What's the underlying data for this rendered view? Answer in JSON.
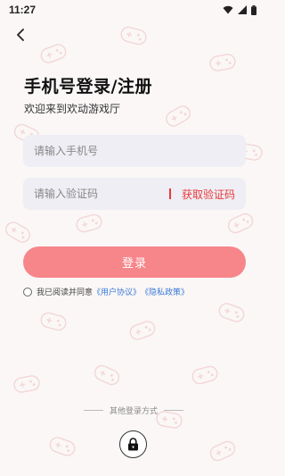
{
  "status_bar": {
    "time": "11:27"
  },
  "page": {
    "title": "手机号登录/注册",
    "subtitle": "欢迎来到欢动游戏厅"
  },
  "phone_field": {
    "placeholder": "请输入手机号"
  },
  "code_field": {
    "placeholder": "请输入验证码",
    "get_code_label": "获取验证码"
  },
  "login_button": {
    "label": "登录"
  },
  "agreement": {
    "prefix": "我已阅读并同意",
    "user_agreement": "《用户协议》",
    "privacy_policy": "《隐私政策》"
  },
  "other_login": {
    "label": "其他登录方式"
  },
  "colors": {
    "accent": "#f7868a",
    "code_link": "#e83a3a",
    "link": "#3a7bd5",
    "background": "#fbf7f7",
    "input_bg": "#eeeef4"
  },
  "icons": {
    "back": "chevron-left-icon",
    "wifi": "wifi-icon",
    "signal": "signal-icon",
    "battery": "battery-icon",
    "lock": "lock-icon",
    "pattern": "gamepad-icon"
  }
}
